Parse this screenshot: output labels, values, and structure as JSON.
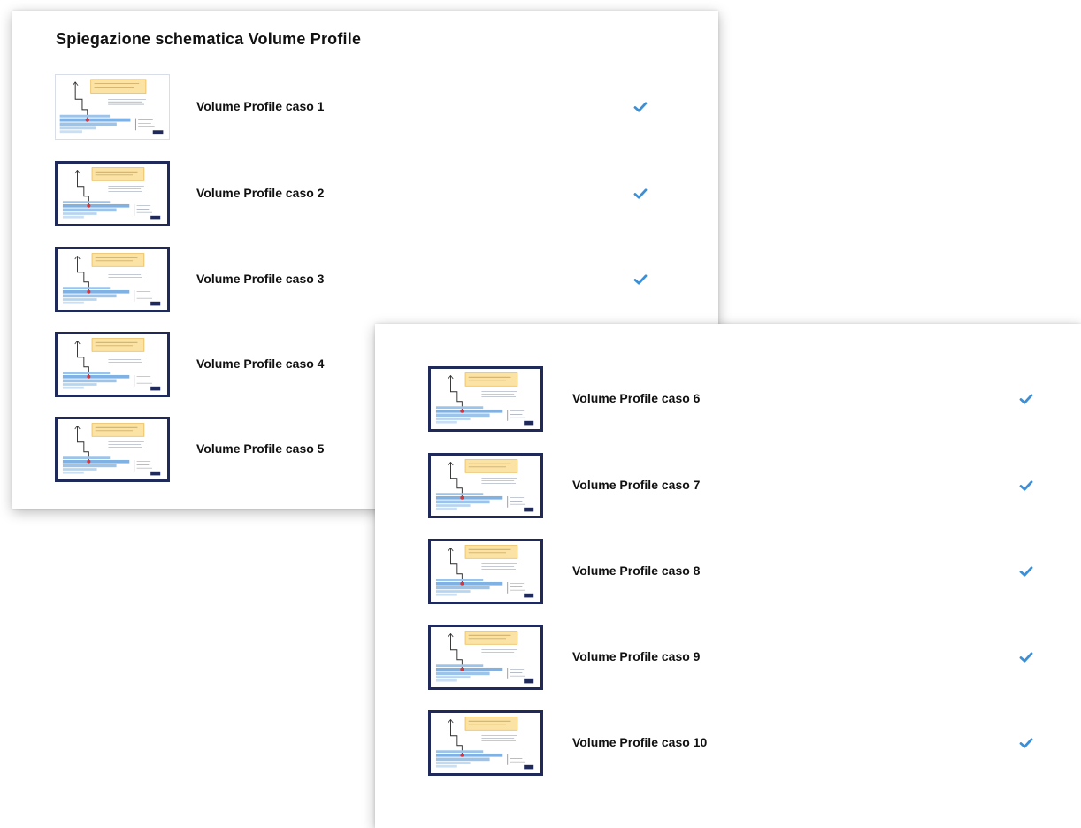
{
  "section_title": "Spiegazione schematica Volume Profile",
  "accent_color": "#3a8fd6",
  "thumbnail_frame_color": "#1f2a5a",
  "lessons": [
    {
      "label": "Volume Profile caso 1",
      "completed": true,
      "icon": "check-icon"
    },
    {
      "label": "Volume Profile caso 2",
      "completed": true,
      "icon": "check-icon"
    },
    {
      "label": "Volume Profile caso 3",
      "completed": true,
      "icon": "check-icon"
    },
    {
      "label": "Volume Profile caso 4",
      "completed": true,
      "icon": "check-icon"
    },
    {
      "label": "Volume Profile caso 5",
      "completed": true,
      "icon": "check-icon"
    },
    {
      "label": "Volume Profile caso 6",
      "completed": true,
      "icon": "check-icon"
    },
    {
      "label": "Volume Profile caso 7",
      "completed": true,
      "icon": "check-icon"
    },
    {
      "label": "Volume Profile caso 8",
      "completed": true,
      "icon": "check-icon"
    },
    {
      "label": "Volume Profile caso 9",
      "completed": true,
      "icon": "check-icon"
    },
    {
      "label": "Volume Profile caso 10",
      "completed": true,
      "icon": "check-icon"
    }
  ]
}
